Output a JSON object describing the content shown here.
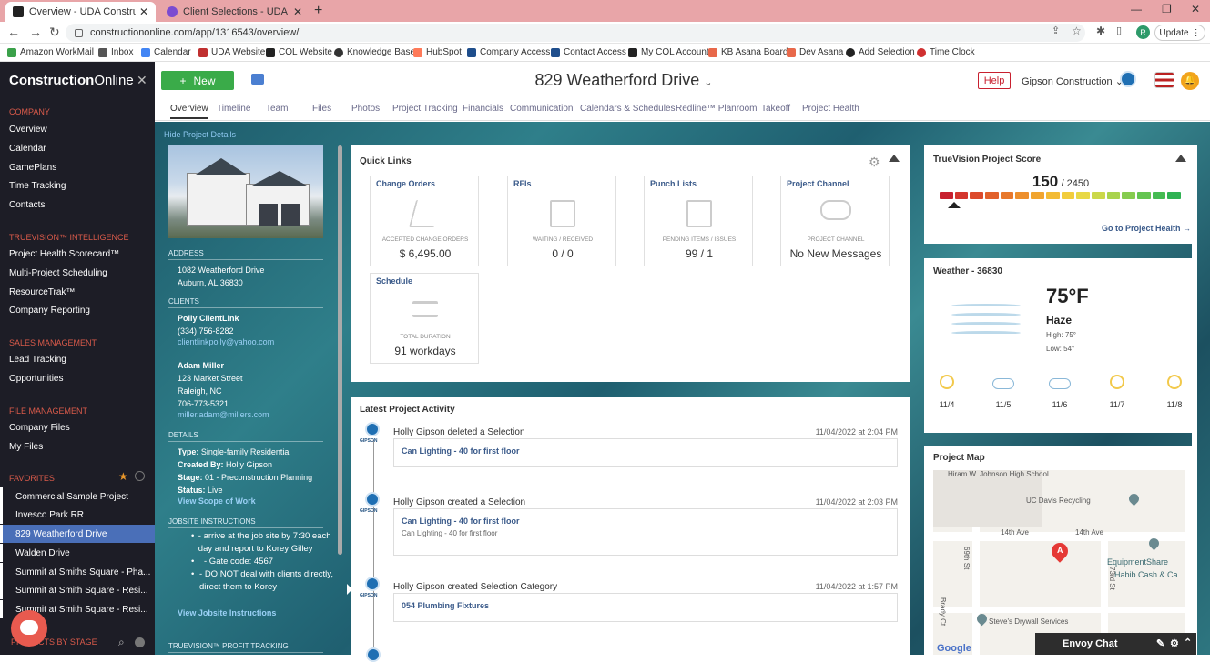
{
  "browser": {
    "tabs": [
      {
        "title": "Overview - UDA ConstructionOnline",
        "favicon_color": "#222"
      },
      {
        "title": "Client Selections - UDA Construction",
        "favicon_color": "#7b4bd1"
      }
    ],
    "url": "constructiononline.com/app/1316543/overview/",
    "update_label": "Update",
    "profile_letter": "R",
    "bookmarks": [
      "Amazon WorkMail",
      "Inbox",
      "Calendar",
      "UDA Website",
      "COL Website",
      "Knowledge Base",
      "HubSpot",
      "Company Access",
      "Contact Access",
      "My COL Account",
      "KB Asana Board",
      "Dev Asana",
      "Add Selection",
      "Time Clock"
    ]
  },
  "sidebar": {
    "logo_bold": "Construction",
    "logo_light": "Online",
    "sections": {
      "company": "COMPANY",
      "truevision": "TRUEVISION™ INTELLIGENCE",
      "sales": "SALES MANAGEMENT",
      "files": "FILE MANAGEMENT",
      "favorites": "FAVORITES",
      "projects_by_stage": "PROJECTS BY STAGE"
    },
    "company_items": [
      "Overview",
      "Calendar",
      "GamePlans",
      "Time Tracking",
      "Contacts"
    ],
    "truevision_items": [
      "Project Health Scorecard™",
      "Multi-Project Scheduling",
      "ResourceTrak™",
      "Company Reporting"
    ],
    "sales_items": [
      "Lead Tracking",
      "Opportunities"
    ],
    "file_items": [
      "Company Files",
      "My Files"
    ],
    "favorites": [
      "Commercial Sample Project",
      "Invesco Park RR",
      "829 Weatherford Drive",
      "Walden Drive",
      "Summit at Smiths Square - Pha...",
      "Summit at Smith Square - Resi...",
      "Summit at Smith Square - Resi..."
    ]
  },
  "header": {
    "new_label": "New",
    "project_title": "829 Weatherford Drive",
    "help_label": "Help",
    "company_name": "Gipson Construction",
    "tabs": [
      "Overview",
      "Timeline",
      "Team",
      "Files",
      "Photos",
      "Project Tracking",
      "Financials",
      "Communication",
      "Calendars & Schedules",
      "Redline™ Planroom",
      "Takeoff",
      "Project Health"
    ]
  },
  "project": {
    "hide_details": "Hide Project Details",
    "address_label": "ADDRESS",
    "address_line1": "1082 Weatherford Drive",
    "address_line2": "Auburn, AL 36830",
    "clients_label": "CLIENTS",
    "client1_name": "Polly ClientLink",
    "client1_phone": "(334) 756-8282",
    "client1_email": "clientlinkpolly@yahoo.com",
    "client2_name": "Adam Miller",
    "client2_addr1": "123 Market Street",
    "client2_addr2": "Raleigh, NC",
    "client2_phone": "706-773-5321",
    "client2_email": "miller.adam@millers.com",
    "details_label": "DETAILS",
    "type_label": "Type:",
    "type_value": "Single-family Residential",
    "created_label": "Created By:",
    "created_value": "Holly Gipson",
    "stage_label": "Stage:",
    "stage_value": "01 - Preconstruction Planning",
    "status_label": "Status:",
    "status_value": "Live",
    "view_scope": "View Scope of Work",
    "jobsite_label": "JOBSITE INSTRUCTIONS",
    "jobsite_items": [
      "- arrive at the job site by 7:30 each day and report to Korey Gilley",
      "- Gate code: 4567",
      "- DO NOT deal with clients directly, direct them to Korey"
    ],
    "view_jobsite": "View Jobsite Instructions",
    "profit_label": "TRUEVISION™ PROFIT TRACKING"
  },
  "quick_links": {
    "title": "Quick Links",
    "items": [
      {
        "title": "Change Orders",
        "sub": "ACCEPTED CHANGE ORDERS",
        "value": "$ 6,495.00"
      },
      {
        "title": "RFIs",
        "sub": "WAITING / RECEIVED",
        "value": "0 / 0"
      },
      {
        "title": "Punch Lists",
        "sub": "PENDING ITEMS / ISSUES",
        "value": "99 / 1"
      },
      {
        "title": "Project Channel",
        "sub": "PROJECT CHANNEL",
        "value": "No New Messages"
      },
      {
        "title": "Schedule",
        "sub": "TOTAL DURATION",
        "value": "91 workdays"
      }
    ]
  },
  "activity": {
    "title": "Latest Project Activity",
    "logo_text": "GIPSON",
    "items": [
      {
        "who": "Holly Gipson deleted a Selection",
        "when": "11/04/2022 at 2:04 PM",
        "line1": "Can Lighting - 40 for first floor",
        "line2": ""
      },
      {
        "who": "Holly Gipson created a Selection",
        "when": "11/04/2022 at 2:03 PM",
        "line1": "Can Lighting - 40 for first floor",
        "line2": "Can Lighting - 40 for first floor"
      },
      {
        "who": "Holly Gipson created Selection Category",
        "when": "11/04/2022 at 1:57 PM",
        "line1": "054 Plumbing Fixtures",
        "line2": ""
      }
    ]
  },
  "truevision": {
    "title": "TrueVision Project Score",
    "score": "150",
    "max": "/ 2450",
    "score_fraction": 0.061,
    "link": "Go to Project Health →",
    "bar_colors": [
      "#c8202f",
      "#d4362e",
      "#dc4a2c",
      "#e2612b",
      "#e8782b",
      "#ed8f2c",
      "#f1a52f",
      "#f3bb35",
      "#f2cd3c",
      "#e8d846",
      "#cbd84a",
      "#a9d34d",
      "#86cc4f",
      "#64c451",
      "#45bb52",
      "#2fb253"
    ]
  },
  "weather": {
    "title": "Weather - 36830",
    "temp": "75°F",
    "cond": "Haze",
    "high": "High: 75°",
    "low": "Low: 54°",
    "days": [
      {
        "label": "11/4",
        "icon": "sun-icon"
      },
      {
        "label": "11/5",
        "icon": "rain-icon"
      },
      {
        "label": "11/6",
        "icon": "rain-icon"
      },
      {
        "label": "11/7",
        "icon": "partly-cloudy-icon"
      },
      {
        "label": "11/8",
        "icon": "partly-cloudy-icon"
      }
    ]
  },
  "map": {
    "title": "Project Map",
    "labels": [
      "Hiram W. Johnson High School",
      "UC Davis Recycling",
      "14th Ave",
      "14th Ave",
      "EquipmentShare",
      "Habib Cash & Ca",
      "Steve's Drywall Services",
      "69th St",
      "73rd St",
      "Brady Ct"
    ],
    "marker": "A",
    "google": "Google"
  },
  "envoy": {
    "label": "Envoy Chat"
  }
}
